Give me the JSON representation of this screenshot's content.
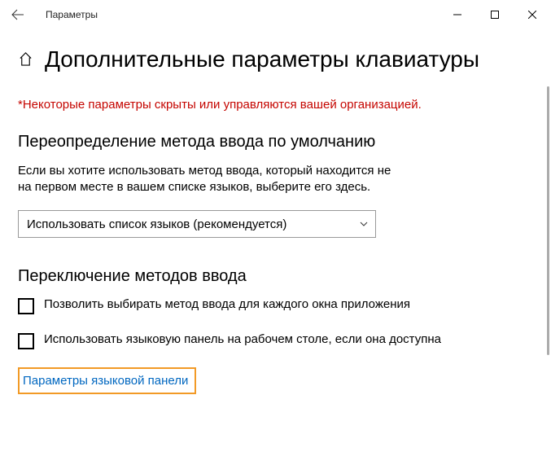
{
  "titlebar": {
    "title": "Параметры"
  },
  "page": {
    "title": "Дополнительные параметры клавиатуры",
    "warning": "*Некоторые параметры скрыты или управляются вашей организацией."
  },
  "section1": {
    "title": "Переопределение метода ввода по умолчанию",
    "desc": "Если вы хотите использовать метод ввода, который находится не на первом месте в вашем списке языков, выберите его здесь.",
    "dropdown_value": "Использовать список языков (рекомендуется)"
  },
  "section2": {
    "title": "Переключение методов ввода",
    "checkbox1": "Позволить выбирать метод ввода для каждого окна приложения",
    "checkbox2": "Использовать языковую панель на рабочем столе, если она доступна",
    "link": "Параметры языковой панели"
  }
}
